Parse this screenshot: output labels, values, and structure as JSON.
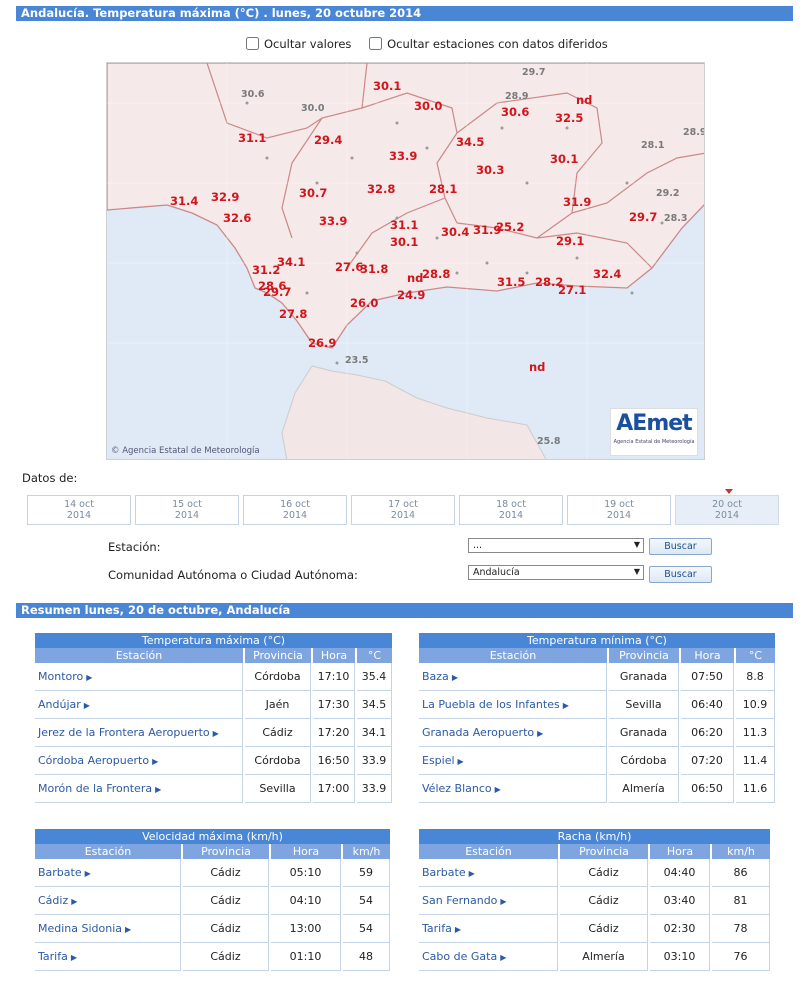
{
  "header": {
    "title": "Andalucía. Temperatura máxima (°C) . lunes, 20 octubre 2014"
  },
  "options": {
    "hide_values": "Ocultar valores",
    "hide_deferred": "Ocultar estaciones con datos diferidos"
  },
  "map": {
    "credit": "Agencia Estatal de Meteorología",
    "logo": "AEmet",
    "logo_sub": "Agencia Estatal de Meteorología",
    "labels": [
      {
        "t": "30.1",
        "c": "r"
      },
      {
        "t": "30.0",
        "c": "r"
      },
      {
        "t": "nd",
        "c": "r"
      },
      {
        "t": "30.6",
        "c": "r"
      },
      {
        "t": "32.5",
        "c": "r"
      },
      {
        "t": "31.1",
        "c": "r"
      },
      {
        "t": "29.4",
        "c": "r"
      },
      {
        "t": "33.9",
        "c": "r"
      },
      {
        "t": "34.5",
        "c": "r"
      },
      {
        "t": "30.1",
        "c": "r"
      },
      {
        "t": "30.3",
        "c": "r"
      },
      {
        "t": "30.7",
        "c": "r"
      },
      {
        "t": "32.8",
        "c": "r"
      },
      {
        "t": "28.1",
        "c": "r"
      },
      {
        "t": "31.9",
        "c": "r"
      },
      {
        "t": "31.4",
        "c": "r"
      },
      {
        "t": "32.9",
        "c": "r"
      },
      {
        "t": "32.6",
        "c": "r"
      },
      {
        "t": "33.9",
        "c": "r"
      },
      {
        "t": "29.7",
        "c": "r"
      },
      {
        "t": "31.1",
        "c": "r"
      },
      {
        "t": "30.1",
        "c": "r"
      },
      {
        "t": "30.4",
        "c": "r"
      },
      {
        "t": "31.9",
        "c": "r"
      },
      {
        "t": "25.2",
        "c": "r"
      },
      {
        "t": "29.1",
        "c": "r"
      },
      {
        "t": "34.1",
        "c": "r"
      },
      {
        "t": "31.2",
        "c": "r"
      },
      {
        "t": "27.6",
        "c": "r"
      },
      {
        "t": "31.8",
        "c": "r"
      },
      {
        "t": "nd",
        "c": "r"
      },
      {
        "t": "28.8",
        "c": "r"
      },
      {
        "t": "28.6",
        "c": "r"
      },
      {
        "t": "29.7",
        "c": "r"
      },
      {
        "t": "26.0",
        "c": "r"
      },
      {
        "t": "24.9",
        "c": "r"
      },
      {
        "t": "31.5",
        "c": "r"
      },
      {
        "t": "28.2",
        "c": "r"
      },
      {
        "t": "27.1",
        "c": "r"
      },
      {
        "t": "32.4",
        "c": "r"
      },
      {
        "t": "27.8",
        "c": "r"
      },
      {
        "t": "26.9",
        "c": "r"
      },
      {
        "t": "nd",
        "c": "r"
      },
      {
        "t": "29.7",
        "c": "g"
      },
      {
        "t": "30.6",
        "c": "g"
      },
      {
        "t": "30.0",
        "c": "g"
      },
      {
        "t": "28.9",
        "c": "g"
      },
      {
        "t": "28.9",
        "c": "g"
      },
      {
        "t": "28.1",
        "c": "g"
      },
      {
        "t": "29.2",
        "c": "g"
      },
      {
        "t": "28.3",
        "c": "g"
      },
      {
        "t": "23.5",
        "c": "g"
      },
      {
        "t": "25.8",
        "c": "g"
      }
    ]
  },
  "dates": {
    "label": "Datos de:",
    "tabs": [
      {
        "d": "14 oct",
        "y": "2014"
      },
      {
        "d": "15 oct",
        "y": "2014"
      },
      {
        "d": "16 oct",
        "y": "2014"
      },
      {
        "d": "17 oct",
        "y": "2014"
      },
      {
        "d": "18 oct",
        "y": "2014"
      },
      {
        "d": "19 oct",
        "y": "2014"
      },
      {
        "d": "20 oct",
        "y": "2014"
      }
    ]
  },
  "form": {
    "station_label": "Estación:",
    "station_value": "...",
    "region_label": "Comunidad Autónoma o Ciudad Autónoma:",
    "region_value": "Andalucía",
    "search": "Buscar"
  },
  "summary": {
    "title": "Resumen lunes, 20 de octubre, Andalucía"
  },
  "tables": [
    {
      "caption": "Temperatura máxima (°C)",
      "cols": [
        "Estación",
        "Provincia",
        "Hora",
        "°C"
      ],
      "rows": [
        [
          "Montoro",
          "Córdoba",
          "17:10",
          "35.4"
        ],
        [
          "Andújar",
          "Jaén",
          "17:30",
          "34.5"
        ],
        [
          "Jerez de la Frontera Aeropuerto",
          "Cádiz",
          "17:20",
          "34.1"
        ],
        [
          "Córdoba Aeropuerto",
          "Córdoba",
          "16:50",
          "33.9"
        ],
        [
          "Morón de la Frontera",
          "Sevilla",
          "17:00",
          "33.9"
        ]
      ]
    },
    {
      "caption": "Temperatura mínima (°C)",
      "cols": [
        "Estación",
        "Provincia",
        "Hora",
        "°C"
      ],
      "rows": [
        [
          "Baza",
          "Granada",
          "07:50",
          "8.8"
        ],
        [
          "La Puebla de los Infantes",
          "Sevilla",
          "06:40",
          "10.9"
        ],
        [
          "Granada Aeropuerto",
          "Granada",
          "06:20",
          "11.3"
        ],
        [
          "Espiel",
          "Córdoba",
          "07:20",
          "11.4"
        ],
        [
          "Vélez Blanco",
          "Almería",
          "06:50",
          "11.6"
        ]
      ]
    },
    {
      "caption": "Velocidad máxima (km/h)",
      "cols": [
        "Estación",
        "Provincia",
        "Hora",
        "km/h"
      ],
      "rows": [
        [
          "Barbate",
          "Cádiz",
          "05:10",
          "59"
        ],
        [
          "Cádiz",
          "Cádiz",
          "04:10",
          "54"
        ],
        [
          "Medina Sidonia",
          "Cádiz",
          "13:00",
          "54"
        ],
        [
          "Tarifa",
          "Cádiz",
          "01:10",
          "48"
        ]
      ]
    },
    {
      "caption": "Racha (km/h)",
      "cols": [
        "Estación",
        "Provincia",
        "Hora",
        "km/h"
      ],
      "rows": [
        [
          "Barbate",
          "Cádiz",
          "04:40",
          "86"
        ],
        [
          "San Fernando",
          "Cádiz",
          "03:40",
          "81"
        ],
        [
          "Tarifa",
          "Cádiz",
          "02:30",
          "78"
        ],
        [
          "Cabo de Gata",
          "Almería",
          "03:10",
          "76"
        ]
      ]
    }
  ]
}
